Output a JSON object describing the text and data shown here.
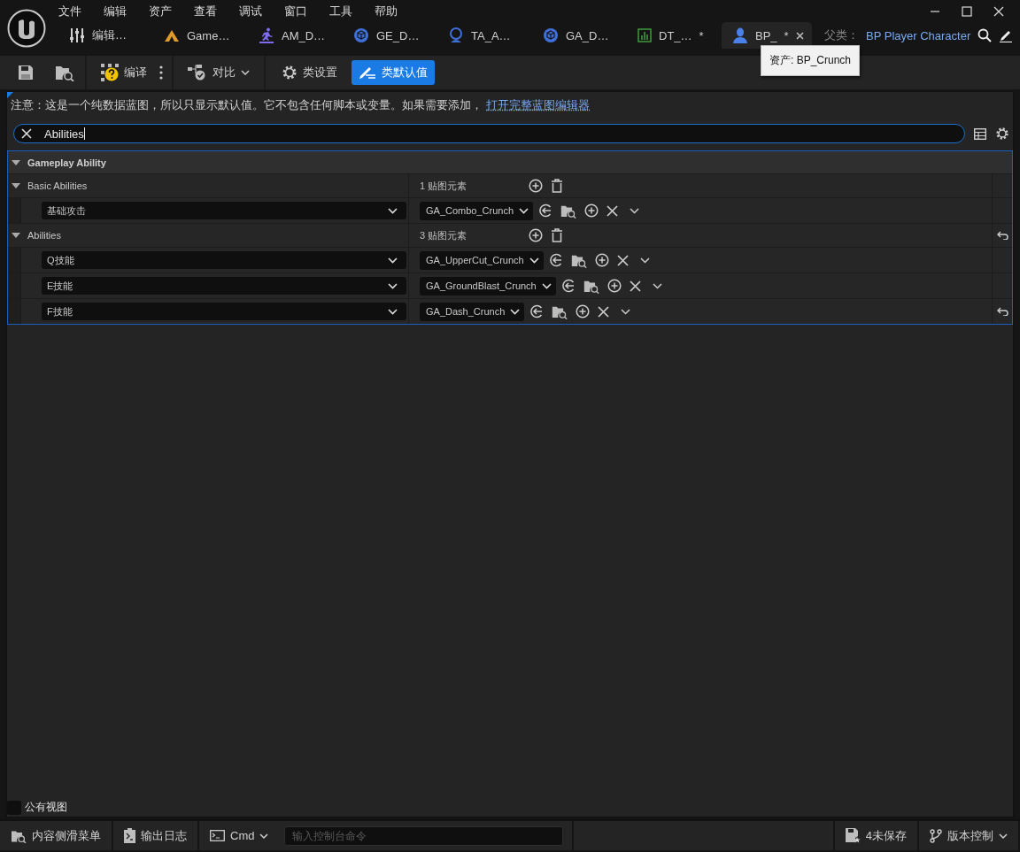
{
  "menu": [
    "文件",
    "编辑",
    "资产",
    "查看",
    "调试",
    "窗口",
    "工具",
    "帮助"
  ],
  "tabs": [
    {
      "kind": "sliders",
      "label": "编辑…",
      "selected": false
    },
    {
      "kind": "triangle",
      "label": "Game…",
      "selected": false
    },
    {
      "kind": "runner",
      "label": "AM_D…",
      "selected": false
    },
    {
      "kind": "cube",
      "label": "GE_D…",
      "selected": false
    },
    {
      "kind": "bust",
      "label": "TA_A…",
      "selected": false
    },
    {
      "kind": "cube",
      "label": "GA_D…",
      "selected": false
    },
    {
      "kind": "chart",
      "label": "DT_…",
      "marker": "*",
      "selected": false
    },
    {
      "kind": "person",
      "label": "BP_",
      "marker": "*",
      "selected": true
    }
  ],
  "parent": {
    "label": "父类：",
    "value": "BP Player Character"
  },
  "tooltip": "资产: BP_Crunch",
  "toolbar": {
    "compile": "编译",
    "diff": "对比",
    "modes": [
      {
        "kind": "gear",
        "label": "类设置",
        "selected": false
      },
      {
        "kind": "pencil",
        "label": "类默认值",
        "selected": true
      }
    ]
  },
  "notice": {
    "text": "注意：这是一个纯数据蓝图，所以只显示默认值。它不包含任何脚本或变量。如果需要添加，",
    "link": "打开完整蓝图编辑器"
  },
  "search": {
    "value": "Abilities"
  },
  "details": {
    "category": "Gameplay Ability",
    "expanded": true,
    "arrays": [
      {
        "name": "Basic Abilities",
        "count": "1 贴图元素",
        "expanded": true,
        "differs": false,
        "entries": [
          {
            "key": "基础攻击",
            "value": "GA_Combo_Crunch",
            "differs": false
          }
        ]
      },
      {
        "name": "Abilities",
        "count": "3 贴图元素",
        "expanded": true,
        "differs": true,
        "entries": [
          {
            "key": "Q技能",
            "value": "GA_UpperCut_Crunch",
            "differs": false
          },
          {
            "key": "E技能",
            "value": "GA_GroundBlast_Crunch",
            "differs": false
          },
          {
            "key": "F技能",
            "value": "GA_Dash_Crunch",
            "differs": true
          }
        ]
      }
    ]
  },
  "public_view": {
    "label": "公有视图",
    "checked": false
  },
  "status_bar": {
    "content_drawer": "内容侧滑菜单",
    "output_log": "输出日志",
    "cmd": "Cmd",
    "console_placeholder": "输入控制台命令",
    "unsaved": "4未保存",
    "source_control": "版本控制"
  }
}
